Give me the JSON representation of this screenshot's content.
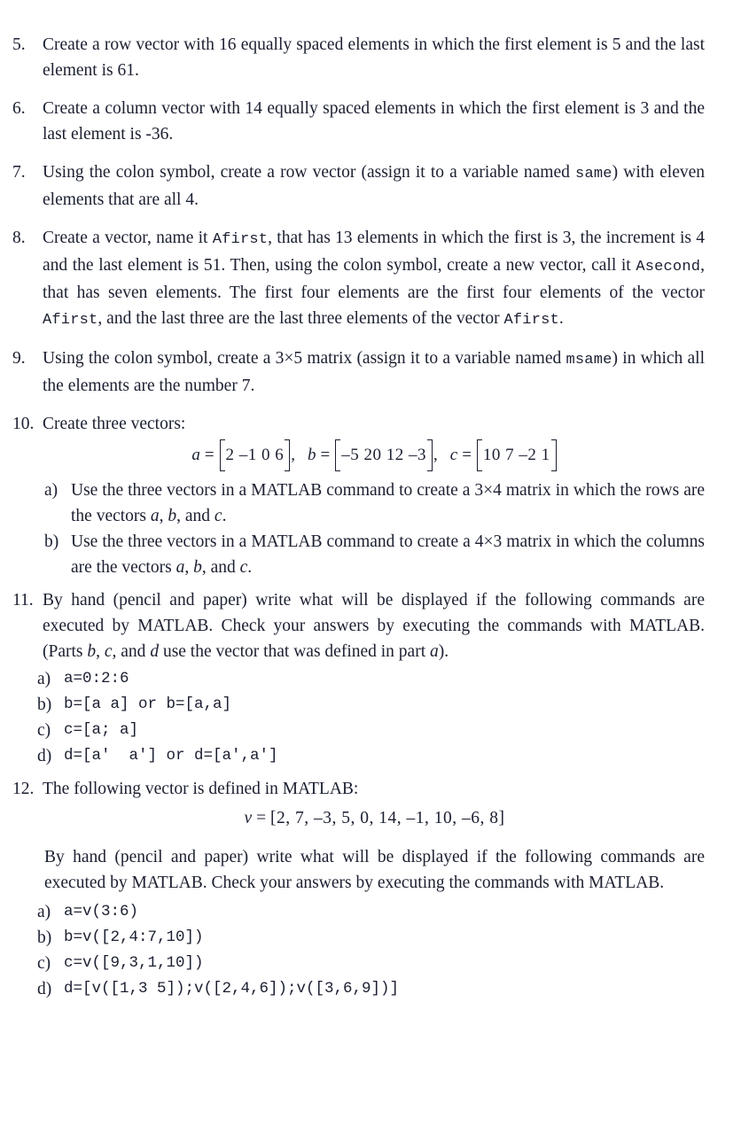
{
  "document": {
    "type": "textbook-problem-set",
    "subject": "MATLAB vectors and matrices"
  },
  "problems": [
    {
      "number": "5.",
      "text": "Create a row vector with 16 equally spaced elements in which the first element is 5 and the last element is 61."
    },
    {
      "number": "6.",
      "text": "Create a column vector with 14 equally spaced elements in which the first element is 3 and the last element is -36."
    },
    {
      "number": "7.",
      "lead": "Using the colon symbol, create a row vector (assign it to a variable named ",
      "code1": "same",
      "tail": ") with eleven elements that are all 4."
    },
    {
      "number": "8.",
      "seg1": "Create a vector, name it ",
      "code1": "Afirst",
      "seg2": ", that has 13 elements in which the first is 3, the increment is 4 and the last element is 51. Then, using the colon symbol, create a new vector, call it ",
      "code2": "Asecond",
      "seg3": ", that has seven elements. The first four elements are the first four elements of the vector ",
      "code3": "Afirst",
      "seg4": ", and the last three are the last three elements of the vector ",
      "code4": "Afirst",
      "seg5": "."
    },
    {
      "number": "9.",
      "seg1": "Using the colon symbol, create a 3×5 matrix (assign it to a variable named ",
      "code1": "msame",
      "seg2": ") in which all the elements are the number 7."
    },
    {
      "number": "10.",
      "text": "Create three vectors:",
      "vectors": [
        {
          "name": "a",
          "values": "2 –1 0 6"
        },
        {
          "name": "b",
          "values": "–5 20 12 –3"
        },
        {
          "name": "c",
          "values": "10 7 –2 1"
        }
      ],
      "subs": [
        {
          "letter": "a)",
          "seg1": "Use the three vectors in a MATLAB command to create a 3×4 matrix in which the rows are the vectors ",
          "v1": "a",
          "sep1": ", ",
          "v2": "b",
          "sep2": ", and ",
          "v3": "c",
          "end": "."
        },
        {
          "letter": "b)",
          "seg1": "Use the three vectors in a MATLAB command to create a 4×3 matrix in which the columns are the vectors ",
          "v1": "a",
          "sep1": ", ",
          "v2": "b",
          "sep2": ", and ",
          "v3": "c",
          "end": "."
        }
      ]
    },
    {
      "number": "11.",
      "seg1": "By hand (pencil and paper) write what will be displayed if the following commands are executed by MATLAB. Check your answers by executing the commands with MATLAB. (Parts ",
      "v1": "b",
      "sep1": ", ",
      "v2": "c",
      "sep2": ", and ",
      "v3": "d",
      "seg2": " use the vector that was defined in part ",
      "v4": "a",
      "seg3": ").",
      "code_lines": [
        {
          "letter": "a)",
          "code": "a=0:2:6"
        },
        {
          "letter": "b)",
          "code": "b=[a a] or b=[a,a]"
        },
        {
          "letter": "c)",
          "code": "c=[a; a]"
        },
        {
          "letter": "d)",
          "code": "d=[a'  a'] or d=[a',a']"
        }
      ]
    },
    {
      "number": "12.",
      "text": "The following vector is defined in MATLAB:",
      "vector_v": {
        "name": "v",
        "display": "[2, 7, –3, 5, 0, 14, –1, 10, –6, 8]",
        "values": [
          2,
          7,
          -3,
          5,
          0,
          14,
          -1,
          10,
          -6,
          8
        ]
      },
      "paragraph": "By hand (pencil and paper) write what will be displayed if the following commands are executed by MATLAB. Check your answers by executing the commands with MATLAB.",
      "code_lines": [
        {
          "letter": "a)",
          "code": "a=v(3:6)"
        },
        {
          "letter": "b)",
          "code": "b=v([2,4:7,10])"
        },
        {
          "letter": "c)",
          "code": "c=v([9,3,1,10])"
        },
        {
          "letter": "d)",
          "code": "d=[v([1,3 5]);v([2,4,6]);v([3,6,9])]"
        }
      ]
    }
  ]
}
